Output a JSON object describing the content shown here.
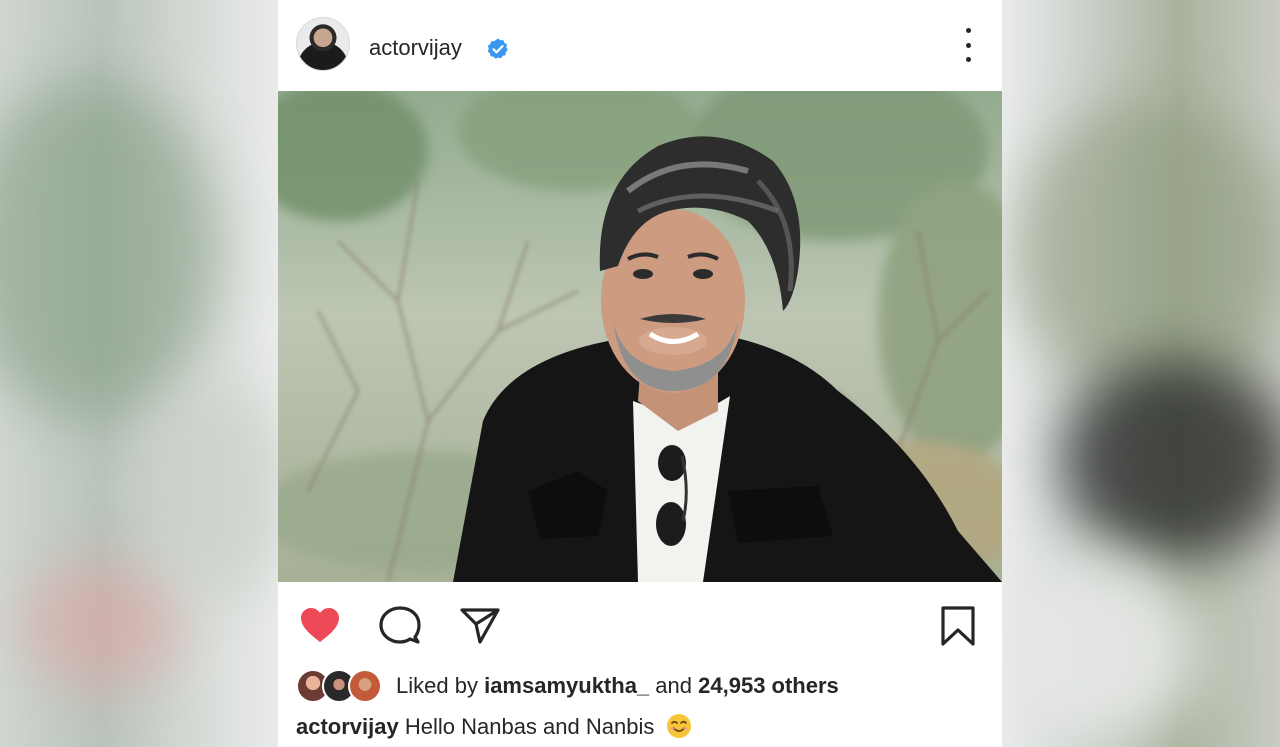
{
  "post": {
    "username": "actorvijay",
    "verified_icon": "verified-badge-icon",
    "menu_icon": "more-vertical-icon"
  },
  "actions": {
    "like_icon": "heart-filled-icon",
    "comment_icon": "comment-icon",
    "share_icon": "share-icon",
    "save_icon": "bookmark-icon"
  },
  "likes": {
    "prefix": "Liked by",
    "user": "iamsamyuktha_",
    "conjunction": "and",
    "count_text": "24,953 others"
  },
  "caption": {
    "username": "actorvijay",
    "text": "Hello Nanbas and Nanbis",
    "emoji": "smiling-face-emoji"
  },
  "colors": {
    "like": "#ed4956",
    "verified": "#3897f0",
    "text": "#262626"
  }
}
